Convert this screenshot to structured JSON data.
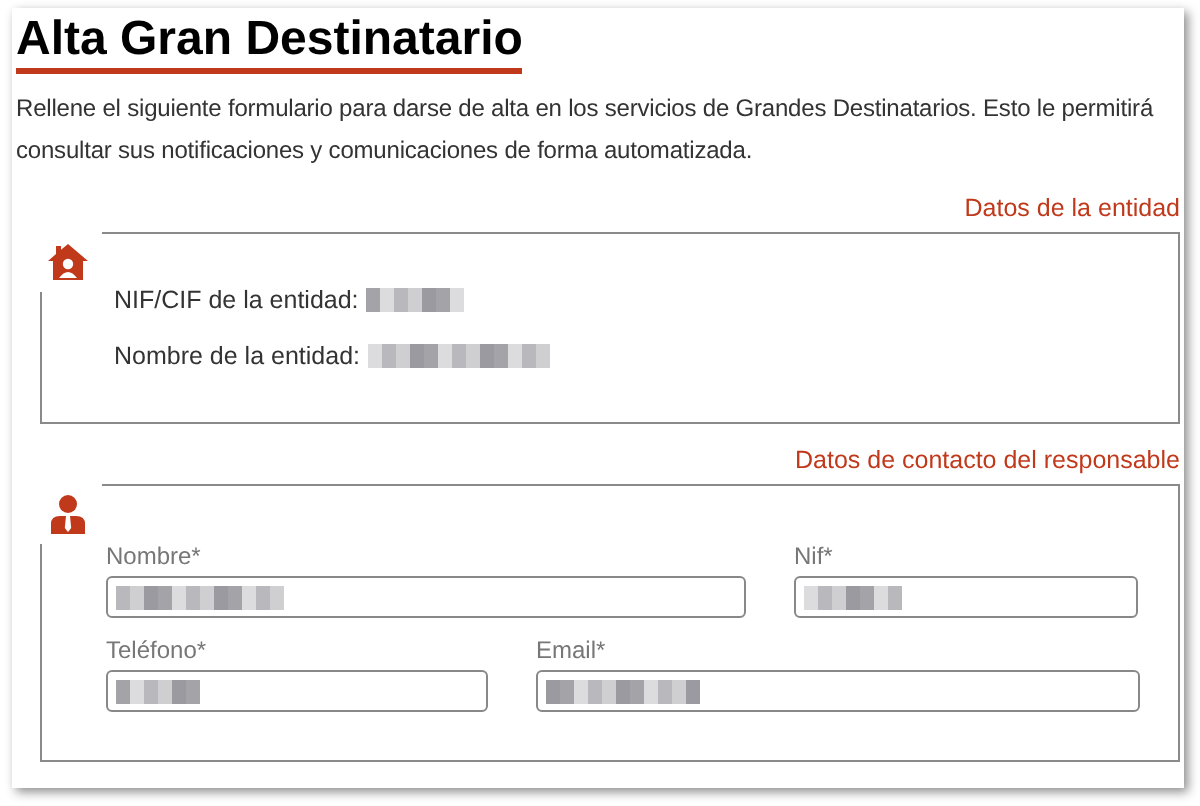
{
  "title": "Alta Gran Destinatario",
  "intro": "Rellene el siguiente formulario para darse de alta en los servicios de Grandes Destinatarios. Esto le permitirá consultar sus notificaciones y comunicaciones de forma automatizada.",
  "sections": [
    {
      "kind": "entity",
      "heading": "Datos de la entidad",
      "rows": [
        {
          "label": "NIF/CIF de la entidad:",
          "redacted": true
        },
        {
          "label": "Nombre de la entidad:",
          "redacted": true
        }
      ]
    },
    {
      "kind": "contact",
      "heading": "Datos de contacto del responsable",
      "fields": [
        {
          "label": "Nombre*",
          "redacted": true
        },
        {
          "label": "Nif*",
          "redacted": true
        },
        {
          "label": "Teléfono*",
          "redacted": true
        },
        {
          "label": "Email*",
          "redacted": true
        }
      ]
    }
  ]
}
